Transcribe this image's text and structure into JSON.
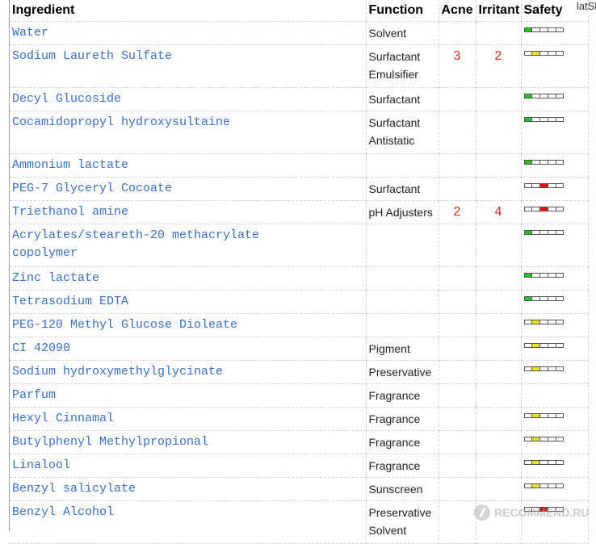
{
  "header": {
    "ingredient": "Ingredient",
    "function": "Function",
    "acne": "Acne",
    "irritant": "Irritant",
    "safety": "Safety"
  },
  "corner_tag": "latShen",
  "colors": {
    "link": "#3a6fc4",
    "rating": "#d8261c",
    "safety_green": "#22c41e",
    "safety_yellow": "#e8e01a",
    "safety_red": "#e01010"
  },
  "rows": [
    {
      "ingredient": "Water",
      "functions": [
        "Solvent"
      ],
      "acne": "",
      "irritant": "",
      "safety_level": 1,
      "safety_color": "green"
    },
    {
      "ingredient": "Sodium Laureth Sulfate",
      "functions": [
        "Surfactant",
        "Emulsifier"
      ],
      "acne": "3",
      "irritant": "2",
      "safety_level": 2,
      "safety_color": "yellow"
    },
    {
      "ingredient": "Decyl Glucoside",
      "functions": [
        "Surfactant"
      ],
      "acne": "",
      "irritant": "",
      "safety_level": 1,
      "safety_color": "green"
    },
    {
      "ingredient": "Cocamidopropyl hydroxysultaine",
      "functions": [
        "Surfactant",
        "Antistatic"
      ],
      "acne": "",
      "irritant": "",
      "safety_level": 1,
      "safety_color": "green"
    },
    {
      "ingredient": "Ammonium lactate",
      "functions": [],
      "acne": "",
      "irritant": "",
      "safety_level": 1,
      "safety_color": "green"
    },
    {
      "ingredient": "PEG-7 Glyceryl Cocoate",
      "functions": [
        "Surfactant"
      ],
      "acne": "",
      "irritant": "",
      "safety_level": 3,
      "safety_color": "red"
    },
    {
      "ingredient": "Triethanol amine",
      "functions": [
        "pH Adjusters"
      ],
      "acne": "2",
      "irritant": "4",
      "safety_level": 3,
      "safety_color": "red"
    },
    {
      "ingredient": "Acrylates/steareth-20 methacrylate copolymer",
      "functions": [],
      "acne": "",
      "irritant": "",
      "safety_level": 1,
      "safety_color": "green"
    },
    {
      "ingredient": "Zinc lactate",
      "functions": [],
      "acne": "",
      "irritant": "",
      "safety_level": 1,
      "safety_color": "green"
    },
    {
      "ingredient": "Tetrasodium EDTA",
      "functions": [],
      "acne": "",
      "irritant": "",
      "safety_level": 1,
      "safety_color": "green"
    },
    {
      "ingredient": "PEG-120 Methyl Glucose Dioleate",
      "functions": [],
      "acne": "",
      "irritant": "",
      "safety_level": 2,
      "safety_color": "yellow"
    },
    {
      "ingredient": "CI 42090",
      "functions": [
        "Pigment"
      ],
      "acne": "",
      "irritant": "",
      "safety_level": 2,
      "safety_color": "yellow"
    },
    {
      "ingredient": "Sodium hydroxymethylglycinate",
      "functions": [
        "Preservative"
      ],
      "acne": "",
      "irritant": "",
      "safety_level": 2,
      "safety_color": "yellow"
    },
    {
      "ingredient": "Parfum",
      "functions": [
        "Fragrance"
      ],
      "acne": "",
      "irritant": "",
      "safety_level": null,
      "safety_color": ""
    },
    {
      "ingredient": "Hexyl Cinnamal",
      "functions": [
        "Fragrance"
      ],
      "acne": "",
      "irritant": "",
      "safety_level": 2,
      "safety_color": "yellow"
    },
    {
      "ingredient": "Butylphenyl Methylpropional",
      "functions": [
        "Fragrance"
      ],
      "acne": "",
      "irritant": "",
      "safety_level": 2,
      "safety_color": "yellow"
    },
    {
      "ingredient": "Linalool",
      "functions": [
        "Fragrance"
      ],
      "acne": "",
      "irritant": "",
      "safety_level": 2,
      "safety_color": "yellow"
    },
    {
      "ingredient": "Benzyl salicylate",
      "functions": [
        "Sunscreen"
      ],
      "acne": "",
      "irritant": "",
      "safety_level": 2,
      "safety_color": "yellow"
    },
    {
      "ingredient": "Benzyl Alcohol",
      "functions": [
        "Preservative",
        "Solvent"
      ],
      "acne": "",
      "irritant": "",
      "safety_level": 3,
      "safety_color": "red"
    }
  ],
  "watermark": "RECOMMEND.RU"
}
